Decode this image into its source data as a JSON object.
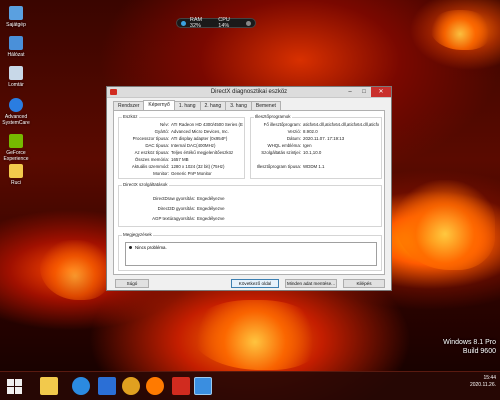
{
  "desktop": {
    "icons": [
      {
        "label": "Sajátgép",
        "icon": "computer-icon",
        "color": "#5aa0e0"
      },
      {
        "label": "Hálózat",
        "icon": "network-icon",
        "color": "#4a90d9"
      },
      {
        "label": "Lomtár",
        "icon": "recycle-bin-icon",
        "color": "#c8d8e8"
      },
      {
        "label": "Advanced SystemCare",
        "icon": "advanced-systemcare-icon",
        "color": "#2a7de1"
      },
      {
        "label": "GeForce Experience",
        "icon": "geforce-icon",
        "color": "#76b900"
      },
      {
        "label": "Ruci",
        "icon": "folder-icon",
        "color": "#f2c94c"
      }
    ]
  },
  "perf_widget": {
    "ram": "RAM 32%",
    "cpu": "CPU 14%"
  },
  "window": {
    "title": "DirectX diagnosztikai eszköz",
    "tabs": [
      "Rendszer",
      "Képernyő",
      "1. hang",
      "2. hang",
      "3. hang",
      "Bemenet"
    ],
    "active_tab": "Képernyő",
    "device": {
      "title": "Eszköz",
      "rows": [
        {
          "k": "Név:",
          "v": "ATI Radeon HD 4300/4500 Series (Engineering"
        },
        {
          "k": "Gyártó:",
          "v": "Advanced Micro Devices, Inc."
        },
        {
          "k": "Processzor típusa:",
          "v": "ATI display adapter (0x954F)"
        },
        {
          "k": "DAC típusa:",
          "v": "Internal DAC(400MHz)"
        },
        {
          "k": "Az eszköz típusa:",
          "v": "Teljes értékű megjelenítőeszköz"
        },
        {
          "k": "Összes memória:",
          "v": "1657 MB"
        },
        {
          "k": "Aktuális üzemmód:",
          "v": "1280 x 1024 (32 bit) (75Hz)"
        },
        {
          "k": "Monitor:",
          "v": "Generic PnP Monitor"
        }
      ]
    },
    "drivers": {
      "title": "Illesztőprogramok",
      "rows": [
        {
          "k": "Fő illesztőprogram:",
          "v": "aticfx64.dll,aticfx64.dll,aticfx64.dll,aticfx32"
        },
        {
          "k": "Verzió:",
          "v": "8.902.0"
        },
        {
          "k": "Dátum:",
          "v": "2020.11.07. 17:19:13"
        },
        {
          "k": "WHQL embléma:",
          "v": "Igen"
        },
        {
          "k": "Szolgáltatás szintjei:",
          "v": "10.1,10.0"
        },
        {
          "k": "Illesztőprogram típusa:",
          "v": "WDDM 1.1"
        }
      ]
    },
    "features": {
      "title": "DirectX szolgáltatások",
      "rows": [
        {
          "k": "DirectDraw gyorsítás:",
          "v": "Engedélyezve"
        },
        {
          "k": "Direct3D gyorsítás:",
          "v": "Engedélyezve"
        },
        {
          "k": "AGP textúragyorsítás:",
          "v": "Engedélyezve"
        }
      ]
    },
    "notes": {
      "title": "Megjegyzések",
      "items": [
        "Nincs probléma."
      ]
    },
    "buttons": {
      "help": "Súgó",
      "next": "Következő oldal",
      "save_all": "Minden adat mentése...",
      "exit": "Kilépés"
    }
  },
  "taskbar": {
    "items": [
      {
        "name": "start-button-icon",
        "color": "#f0f0f0"
      },
      {
        "name": "file-explorer-icon",
        "color": "#f2c94c"
      },
      {
        "name": "internet-explorer-icon",
        "color": "#2b8ae0"
      },
      {
        "name": "store-icon",
        "color": "#2b6fd6"
      },
      {
        "name": "chrome-icon",
        "color": "#e0a020"
      },
      {
        "name": "media-player-icon",
        "color": "#ff7a00"
      },
      {
        "name": "app-red-icon",
        "color": "#d12b1f"
      },
      {
        "name": "dxdiag-icon",
        "color": "#3a8ee0"
      }
    ],
    "time": "15:44",
    "date": "2020.11.26."
  },
  "watermark": {
    "edition": "Windows 8.1 Pro",
    "build": "Build 9600"
  }
}
